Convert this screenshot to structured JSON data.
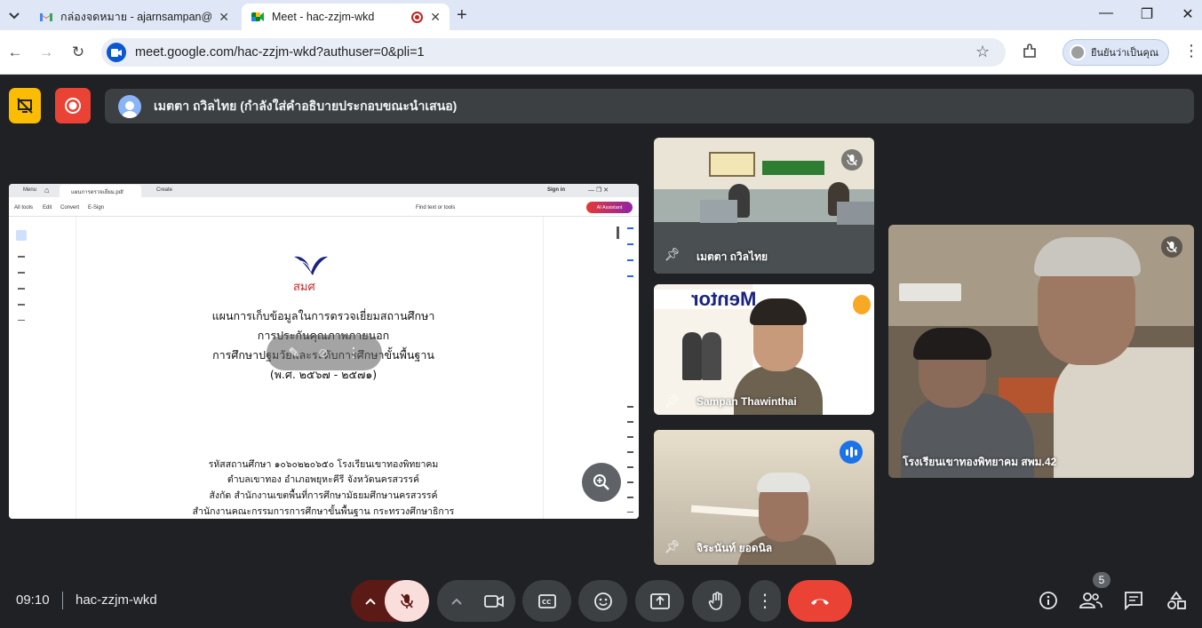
{
  "browser": {
    "tabs": [
      {
        "label": "กล่องจดหมาย - ajarnsampan@gm",
        "active": false
      },
      {
        "label": "Meet - hac-zzjm-wkd",
        "active": true
      }
    ],
    "url": "meet.google.com/hac-zzjm-wkd?authuser=0&pli=1",
    "profile_label": "ยืนยันว่าเป็นคุณ"
  },
  "meet": {
    "presenter_banner": "เมตตา ถวิลไทย (กำลังใส่คำอธิบายประกอบขณะนำเสนอ)",
    "time": "09:10",
    "meeting_code": "hac-zzjm-wkd",
    "participant_count": "5",
    "accent_red": "#ea4335",
    "accent_yellow": "#fbbc04"
  },
  "shared_doc": {
    "top_tabs": {
      "menu": "Menu",
      "file": "แผนการตรวจเยี่ยม.pdf",
      "create": "Create",
      "sign_in": "Sign in"
    },
    "toolbar": {
      "all_tools": "All tools",
      "edit": "Edit",
      "convert": "Convert",
      "esign": "E-Sign",
      "find": "Find text or tools",
      "ai": "AI Assistant"
    },
    "logo_text": "สมศ",
    "title_lines": [
      "แผนการเก็บข้อมูลในการตรวจเยี่ยมสถานศึกษา",
      "การประกันคุณภาพภายนอก",
      "การศึกษาปฐมวัยและระดับการศึกษาขั้นพื้นฐาน",
      "(พ.ศ. ๒๕๖๗ - ๒๕๗๑)"
    ],
    "body_lines": [
      "รหัสสถานศึกษา ๑๐๖๐๒๒๐๖๕๐ โรงเรียนเขาทองพิทยาคม",
      "ตำบลเขาทอง อำเภอพยุหะคีรี จังหวัดนครสวรรค์",
      "สังกัด สำนักงานเขตพื้นที่การศึกษามัธยมศึกษานครสวรรค์",
      "สำนักงานคณะกรรมการการศึกษาขั้นพื้นฐาน กระทรวงศึกษาธิการ"
    ]
  },
  "participants": [
    {
      "name": "เมตตา ถวิลไทย",
      "muted": true
    },
    {
      "name": "Sampan Thawinthai",
      "muted": false
    },
    {
      "name": "จิระนันท์ ยอดนิล",
      "muted": false,
      "speaking": true
    },
    {
      "name": "โรงเรียนเขาทองพิทยาคม สพม.42",
      "muted": true
    }
  ],
  "tile_banner_text": "Mentor"
}
